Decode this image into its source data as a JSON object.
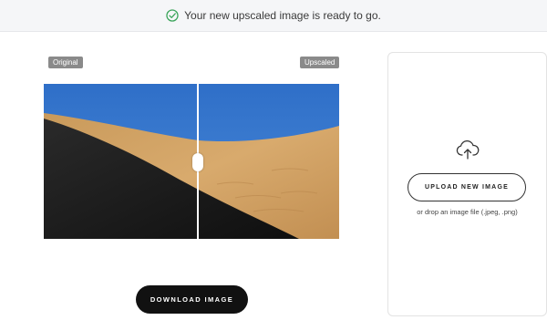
{
  "banner": {
    "message": "Your new upscaled image is ready to go.",
    "icon": "check-circle-icon",
    "accent": "#3aa45a"
  },
  "compare": {
    "left_label": "Original",
    "right_label": "Upscaled",
    "divider_position": 0.52
  },
  "actions": {
    "download_label": "DOWNLOAD IMAGE"
  },
  "upload": {
    "icon": "cloud-upload-icon",
    "button_label": "UPLOAD NEW IMAGE",
    "hint": "or drop an image file (.jpeg, .png)"
  }
}
